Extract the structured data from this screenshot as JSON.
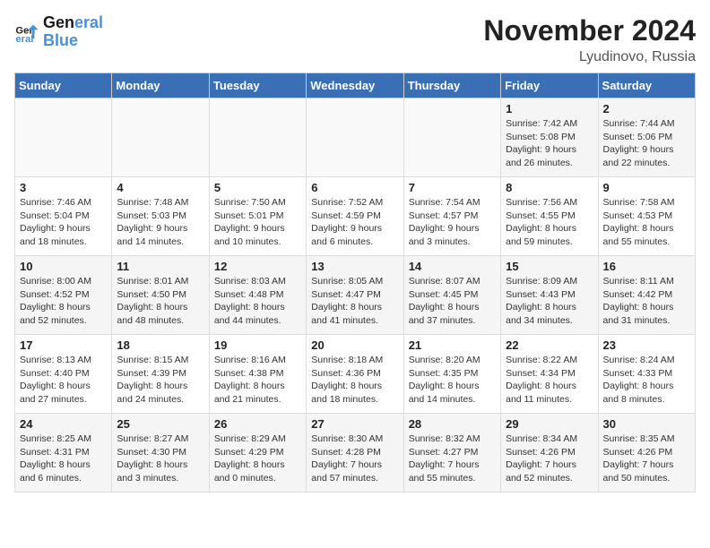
{
  "header": {
    "logo_line1": "General",
    "logo_line2": "Blue",
    "month": "November 2024",
    "location": "Lyudinovo, Russia"
  },
  "weekdays": [
    "Sunday",
    "Monday",
    "Tuesday",
    "Wednesday",
    "Thursday",
    "Friday",
    "Saturday"
  ],
  "weeks": [
    [
      {
        "day": "",
        "info": ""
      },
      {
        "day": "",
        "info": ""
      },
      {
        "day": "",
        "info": ""
      },
      {
        "day": "",
        "info": ""
      },
      {
        "day": "",
        "info": ""
      },
      {
        "day": "1",
        "info": "Sunrise: 7:42 AM\nSunset: 5:08 PM\nDaylight: 9 hours and 26 minutes."
      },
      {
        "day": "2",
        "info": "Sunrise: 7:44 AM\nSunset: 5:06 PM\nDaylight: 9 hours and 22 minutes."
      }
    ],
    [
      {
        "day": "3",
        "info": "Sunrise: 7:46 AM\nSunset: 5:04 PM\nDaylight: 9 hours and 18 minutes."
      },
      {
        "day": "4",
        "info": "Sunrise: 7:48 AM\nSunset: 5:03 PM\nDaylight: 9 hours and 14 minutes."
      },
      {
        "day": "5",
        "info": "Sunrise: 7:50 AM\nSunset: 5:01 PM\nDaylight: 9 hours and 10 minutes."
      },
      {
        "day": "6",
        "info": "Sunrise: 7:52 AM\nSunset: 4:59 PM\nDaylight: 9 hours and 6 minutes."
      },
      {
        "day": "7",
        "info": "Sunrise: 7:54 AM\nSunset: 4:57 PM\nDaylight: 9 hours and 3 minutes."
      },
      {
        "day": "8",
        "info": "Sunrise: 7:56 AM\nSunset: 4:55 PM\nDaylight: 8 hours and 59 minutes."
      },
      {
        "day": "9",
        "info": "Sunrise: 7:58 AM\nSunset: 4:53 PM\nDaylight: 8 hours and 55 minutes."
      }
    ],
    [
      {
        "day": "10",
        "info": "Sunrise: 8:00 AM\nSunset: 4:52 PM\nDaylight: 8 hours and 52 minutes."
      },
      {
        "day": "11",
        "info": "Sunrise: 8:01 AM\nSunset: 4:50 PM\nDaylight: 8 hours and 48 minutes."
      },
      {
        "day": "12",
        "info": "Sunrise: 8:03 AM\nSunset: 4:48 PM\nDaylight: 8 hours and 44 minutes."
      },
      {
        "day": "13",
        "info": "Sunrise: 8:05 AM\nSunset: 4:47 PM\nDaylight: 8 hours and 41 minutes."
      },
      {
        "day": "14",
        "info": "Sunrise: 8:07 AM\nSunset: 4:45 PM\nDaylight: 8 hours and 37 minutes."
      },
      {
        "day": "15",
        "info": "Sunrise: 8:09 AM\nSunset: 4:43 PM\nDaylight: 8 hours and 34 minutes."
      },
      {
        "day": "16",
        "info": "Sunrise: 8:11 AM\nSunset: 4:42 PM\nDaylight: 8 hours and 31 minutes."
      }
    ],
    [
      {
        "day": "17",
        "info": "Sunrise: 8:13 AM\nSunset: 4:40 PM\nDaylight: 8 hours and 27 minutes."
      },
      {
        "day": "18",
        "info": "Sunrise: 8:15 AM\nSunset: 4:39 PM\nDaylight: 8 hours and 24 minutes."
      },
      {
        "day": "19",
        "info": "Sunrise: 8:16 AM\nSunset: 4:38 PM\nDaylight: 8 hours and 21 minutes."
      },
      {
        "day": "20",
        "info": "Sunrise: 8:18 AM\nSunset: 4:36 PM\nDaylight: 8 hours and 18 minutes."
      },
      {
        "day": "21",
        "info": "Sunrise: 8:20 AM\nSunset: 4:35 PM\nDaylight: 8 hours and 14 minutes."
      },
      {
        "day": "22",
        "info": "Sunrise: 8:22 AM\nSunset: 4:34 PM\nDaylight: 8 hours and 11 minutes."
      },
      {
        "day": "23",
        "info": "Sunrise: 8:24 AM\nSunset: 4:33 PM\nDaylight: 8 hours and 8 minutes."
      }
    ],
    [
      {
        "day": "24",
        "info": "Sunrise: 8:25 AM\nSunset: 4:31 PM\nDaylight: 8 hours and 6 minutes."
      },
      {
        "day": "25",
        "info": "Sunrise: 8:27 AM\nSunset: 4:30 PM\nDaylight: 8 hours and 3 minutes."
      },
      {
        "day": "26",
        "info": "Sunrise: 8:29 AM\nSunset: 4:29 PM\nDaylight: 8 hours and 0 minutes."
      },
      {
        "day": "27",
        "info": "Sunrise: 8:30 AM\nSunset: 4:28 PM\nDaylight: 7 hours and 57 minutes."
      },
      {
        "day": "28",
        "info": "Sunrise: 8:32 AM\nSunset: 4:27 PM\nDaylight: 7 hours and 55 minutes."
      },
      {
        "day": "29",
        "info": "Sunrise: 8:34 AM\nSunset: 4:26 PM\nDaylight: 7 hours and 52 minutes."
      },
      {
        "day": "30",
        "info": "Sunrise: 8:35 AM\nSunset: 4:26 PM\nDaylight: 7 hours and 50 minutes."
      }
    ]
  ]
}
